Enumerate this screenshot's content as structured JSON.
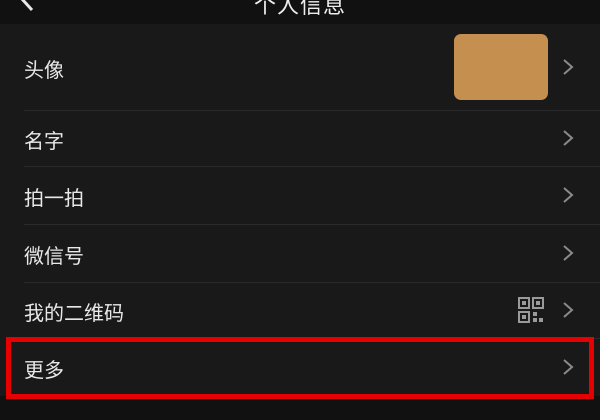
{
  "header": {
    "title": "个人信息",
    "back_icon": "chevron-left-icon"
  },
  "rows": [
    {
      "label": "头像",
      "avatar_color": "#c58f4f"
    },
    {
      "label": "名字"
    },
    {
      "label": "拍一拍"
    },
    {
      "label": "微信号"
    },
    {
      "label": "我的二维码",
      "extra_icon": "qr-code-icon"
    },
    {
      "label": "更多",
      "highlighted": true
    }
  ],
  "colors": {
    "background": "#111111",
    "list_background": "#191919",
    "highlight": "#e60000",
    "chevron": "#8a8a8a"
  }
}
